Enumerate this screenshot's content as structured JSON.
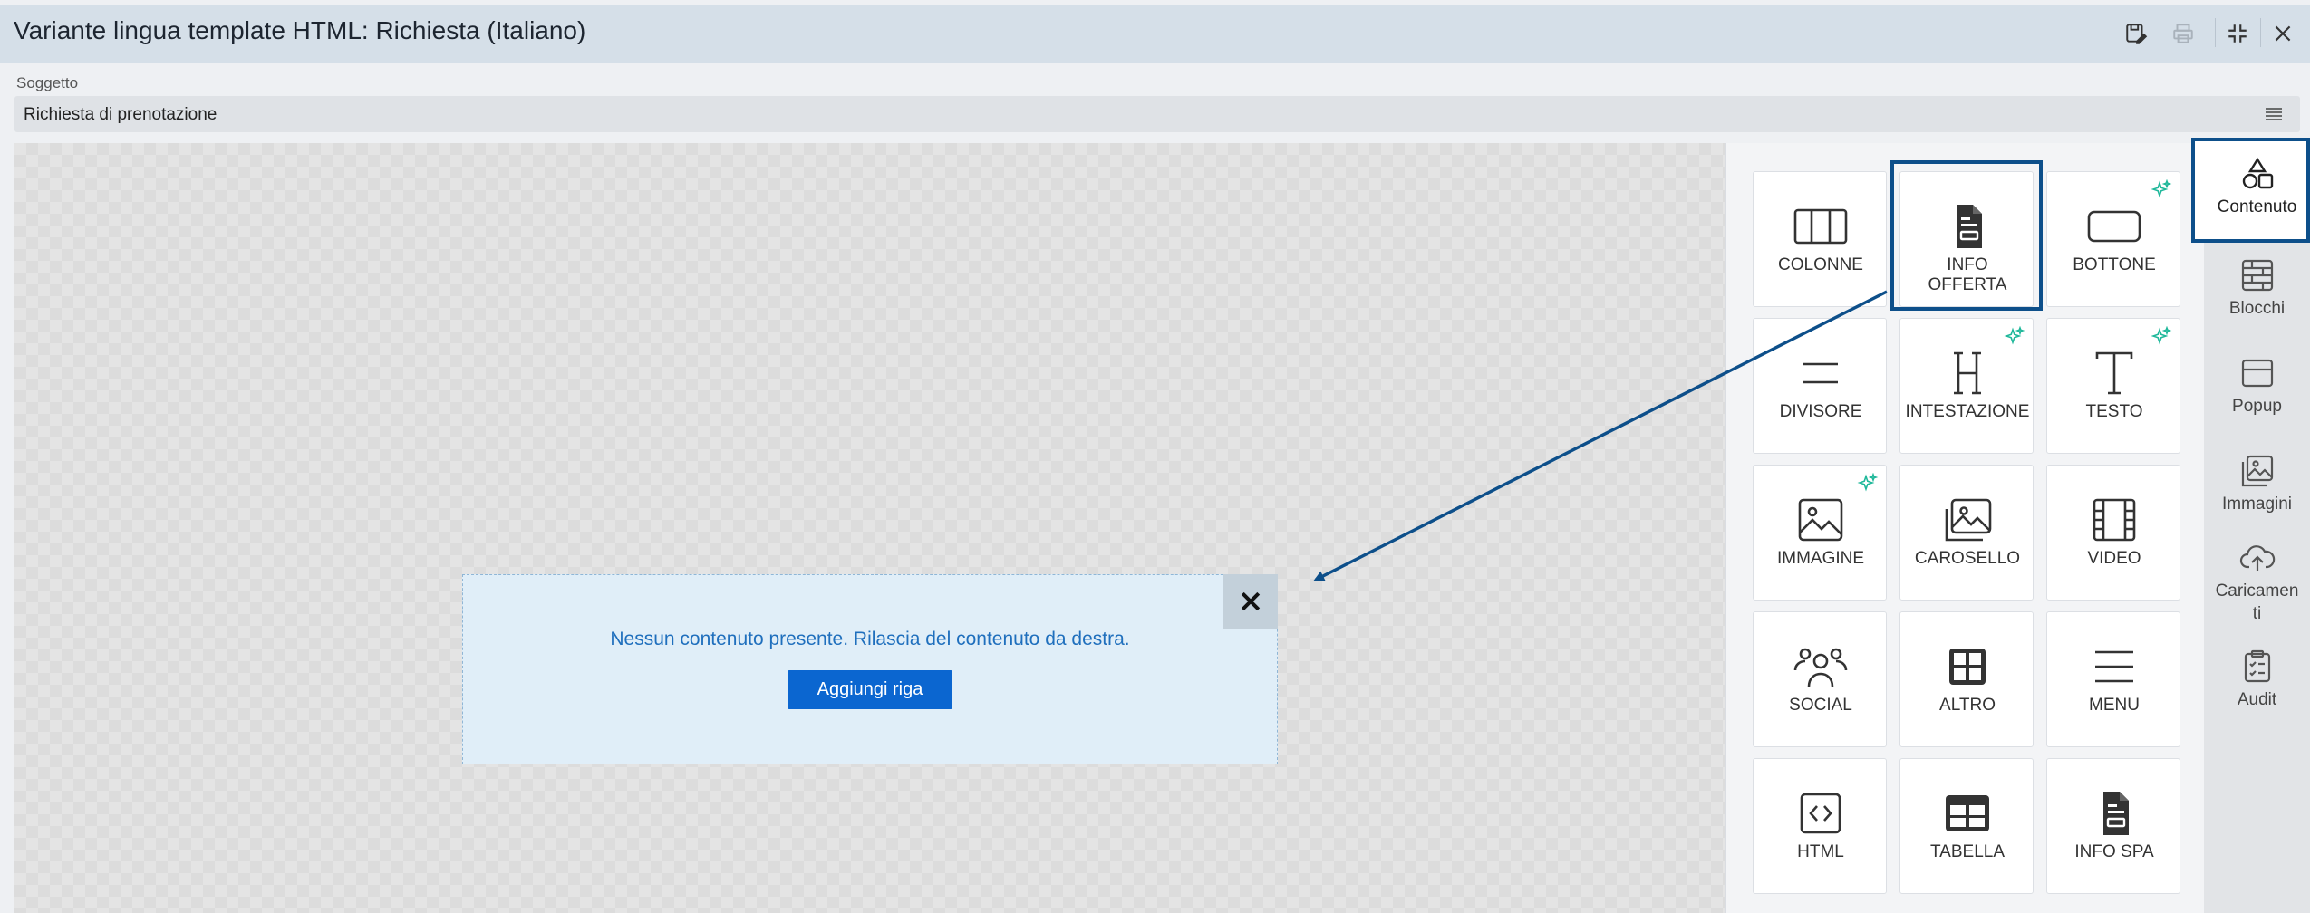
{
  "window": {
    "title": "Variante lingua template HTML: Richiesta (Italiano)",
    "toolbar_icons": [
      "save-icon",
      "print-icon",
      "fullscreen-icon",
      "close-icon"
    ]
  },
  "subject": {
    "label": "Soggetto",
    "value": "Richiesta di prenotazione",
    "menu_icon": "hamburger-icon"
  },
  "canvas": {
    "empty_message": "Nessun contenuto presente. Rilascia del contenuto da destra.",
    "add_row_label": "Aggiungi riga",
    "close_icon": "close-icon"
  },
  "content_tiles": [
    {
      "label": "COLONNE",
      "icon": "columns-icon",
      "ai": false
    },
    {
      "label": "INFO\nOFFERTA",
      "icon": "document-icon",
      "ai": false,
      "highlighted": true
    },
    {
      "label": "BOTTONE",
      "icon": "button-icon",
      "ai": true
    },
    {
      "label": "DIVISORE",
      "icon": "divider-icon",
      "ai": false
    },
    {
      "label": "INTESTAZIONE",
      "icon": "heading-icon",
      "ai": true
    },
    {
      "label": "TESTO",
      "icon": "text-icon",
      "ai": true
    },
    {
      "label": "IMMAGINE",
      "icon": "image-icon",
      "ai": true
    },
    {
      "label": "CAROSELLO",
      "icon": "carousel-icon",
      "ai": false
    },
    {
      "label": "VIDEO",
      "icon": "video-icon",
      "ai": false
    },
    {
      "label": "SOCIAL",
      "icon": "social-icon",
      "ai": false
    },
    {
      "label": "ALTRO",
      "icon": "grid-icon",
      "ai": false
    },
    {
      "label": "MENU",
      "icon": "menu-icon",
      "ai": false
    },
    {
      "label": "HTML",
      "icon": "html-icon",
      "ai": false
    },
    {
      "label": "TABELLA",
      "icon": "table-icon",
      "ai": false
    },
    {
      "label": "INFO SPA",
      "icon": "document-icon",
      "ai": false
    }
  ],
  "side_rail": [
    {
      "label": "Contenuto",
      "icon": "shapes-icon",
      "active": true
    },
    {
      "label": "Blocchi",
      "icon": "bricks-icon"
    },
    {
      "label": "Popup",
      "icon": "popup-icon"
    },
    {
      "label": "Immagini",
      "icon": "images-icon"
    },
    {
      "label": "Caricamen\nti",
      "icon": "cloud-upload-icon"
    },
    {
      "label": "Audit",
      "icon": "clipboard-check-icon"
    }
  ],
  "colors": {
    "accent": "#0b66d0",
    "highlight": "#0d4f8a",
    "ai_sparkle": "#1fb89a",
    "link_text": "#1f6fbd"
  }
}
